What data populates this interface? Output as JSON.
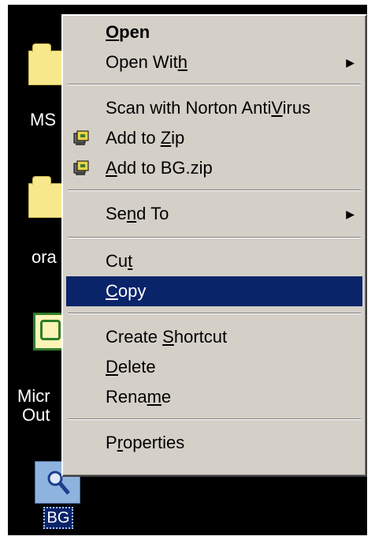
{
  "desktop": {
    "icons": [
      {
        "label": "MS"
      },
      {
        "label": "ora"
      },
      {
        "label_line1": "Micr",
        "label_line2": "Out"
      },
      {
        "label": "BG"
      }
    ]
  },
  "context_menu": {
    "items": {
      "open": {
        "pre": "",
        "accel": "O",
        "post": "pen"
      },
      "open_with": {
        "pre": "Open Wit",
        "accel": "h",
        "post": ""
      },
      "scan": {
        "pre": "Scan with Norton Anti",
        "accel": "V",
        "post": "irus"
      },
      "add_zip": {
        "pre": "Add to ",
        "accel": "Z",
        "post": "ip"
      },
      "add_bg_zip": {
        "pre": "",
        "accel": "A",
        "post": "dd to BG.zip"
      },
      "send_to": {
        "pre": "Se",
        "accel": "n",
        "post": "d To"
      },
      "cut": {
        "pre": "Cu",
        "accel": "t",
        "post": ""
      },
      "copy": {
        "pre": "",
        "accel": "C",
        "post": "opy"
      },
      "create_shortcut": {
        "pre": "Create ",
        "accel": "S",
        "post": "hortcut"
      },
      "delete": {
        "pre": "",
        "accel": "D",
        "post": "elete"
      },
      "rename": {
        "pre": "Rena",
        "accel": "m",
        "post": "e"
      },
      "properties": {
        "pre": "P",
        "accel": "r",
        "post": "operties"
      }
    },
    "submenu_arrow": "▶",
    "selected_item": "copy",
    "colors": {
      "menu_bg": "#d4d0c8",
      "highlight": "#0a246a",
      "desktop": "#000000"
    }
  }
}
